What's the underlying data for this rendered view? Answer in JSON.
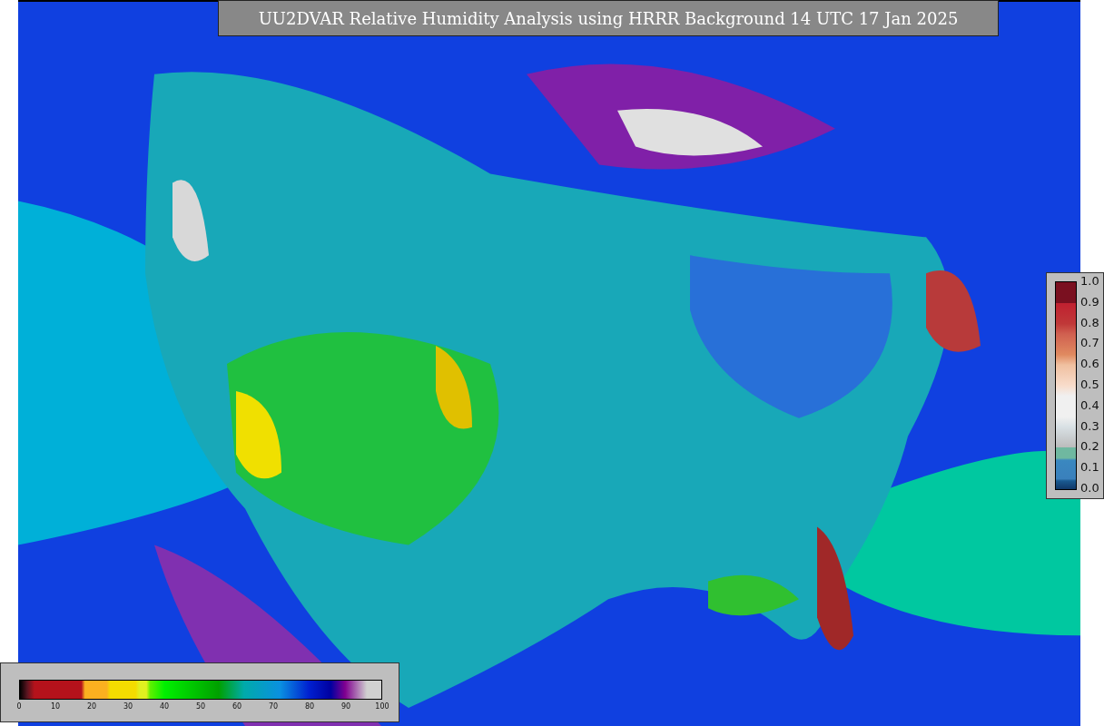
{
  "title": "UU2DVAR Relative Humidity Analysis using HRRR Background 14 UTC 17 Jan 2025",
  "humidity_scale": {
    "ticks": [
      "0",
      "10",
      "20",
      "30",
      "40",
      "50",
      "60",
      "70",
      "80",
      "90",
      "100"
    ]
  },
  "ratio_scale": {
    "ticks": [
      "1.0",
      "0.9",
      "0.8",
      "0.7",
      "0.6",
      "0.5",
      "0.4",
      "0.3",
      "0.2",
      "0.1",
      "0.0"
    ]
  }
}
